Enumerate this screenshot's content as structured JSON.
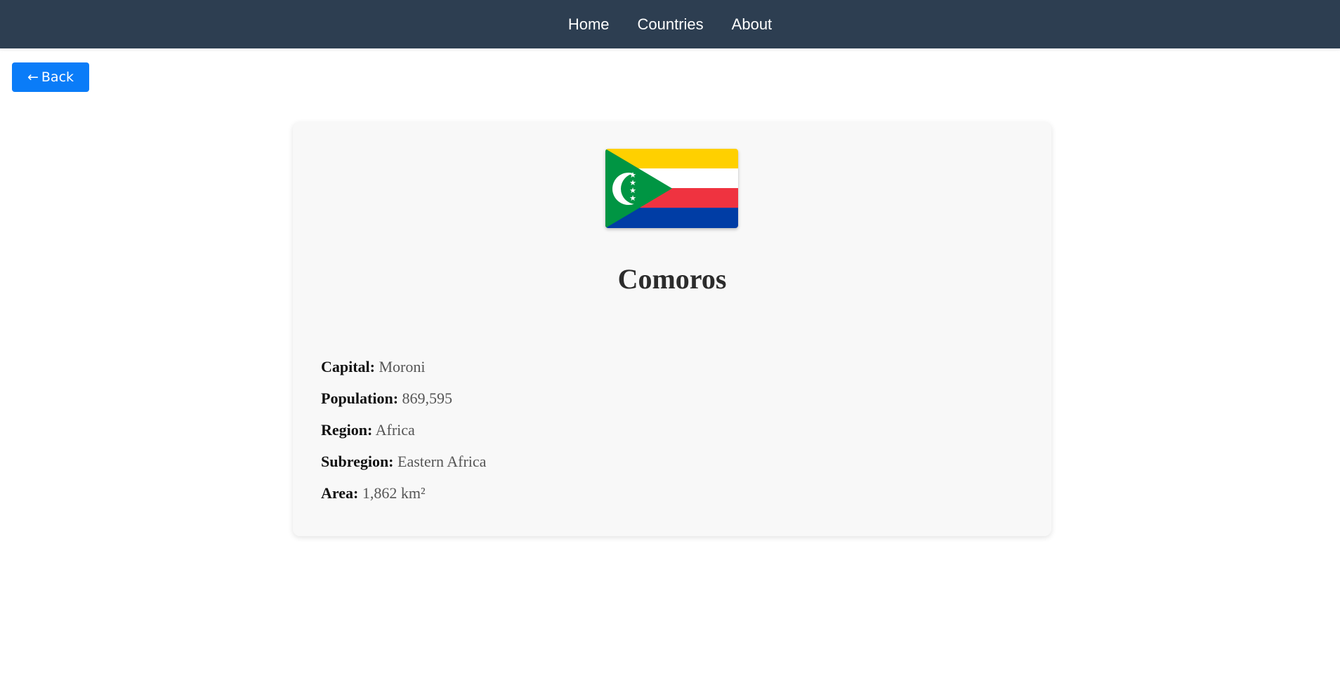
{
  "nav": {
    "links": [
      "Home",
      "Countries",
      "About"
    ]
  },
  "back_button": {
    "arrow": "←",
    "label": "Back"
  },
  "country": {
    "name": "Comoros",
    "flag_icon": "comoros-flag",
    "details": [
      {
        "label": "Capital:",
        "value": "Moroni"
      },
      {
        "label": "Population:",
        "value": "869,595"
      },
      {
        "label": "Region:",
        "value": "Africa"
      },
      {
        "label": "Subregion:",
        "value": "Eastern Africa"
      },
      {
        "label": "Area:",
        "value": "1,862 km²"
      }
    ]
  },
  "colors": {
    "navbar": "#2d3e51",
    "accent": "#0a7cf8",
    "card": "#f8f8f8",
    "flag_yellow": "#ffd000",
    "flag_white": "#ffffff",
    "flag_red": "#ef3340",
    "flag_blue": "#003da5",
    "flag_green": "#009543"
  }
}
